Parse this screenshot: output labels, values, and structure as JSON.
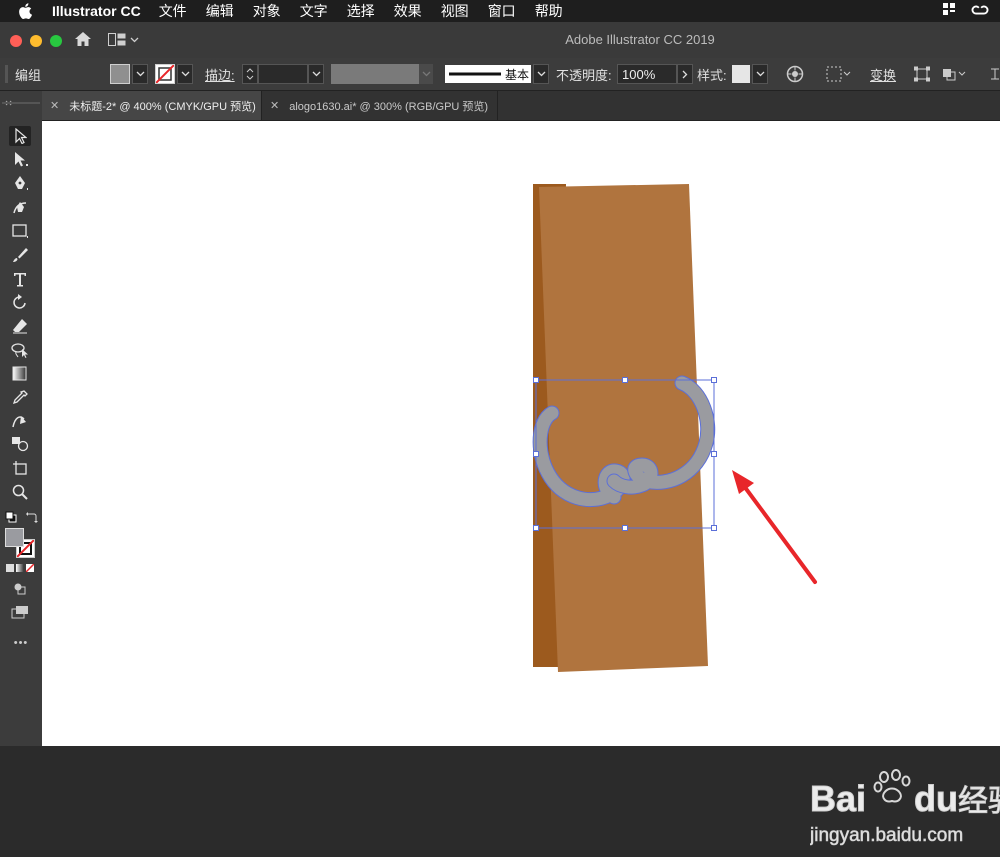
{
  "menubar": {
    "app_name": "Illustrator CC",
    "items": [
      "文件",
      "编辑",
      "对象",
      "文字",
      "选择",
      "效果",
      "视图",
      "窗口",
      "帮助"
    ]
  },
  "window": {
    "title": "Adobe Illustrator CC 2019"
  },
  "control_bar": {
    "selection_label": "编组",
    "stroke_label": "描边:",
    "stroke_profile": "基本",
    "opacity_label": "不透明度:",
    "opacity_value": "100%",
    "style_label": "样式:",
    "transform_label": "变换"
  },
  "tabs": [
    {
      "label": "未标题-2* @ 400% (CMYK/GPU 预览)",
      "active": true
    },
    {
      "label": "alogo1630.ai* @ 300% (RGB/GPU 预览)",
      "active": false
    }
  ],
  "toolbar": {
    "more_label": "•••"
  },
  "colors": {
    "accent_red": "#e8262a",
    "wood": "#b0743e",
    "wood_dark": "#9c5a1e",
    "selection": "#5b6fd8",
    "ornament": "#9a9ba0"
  },
  "watermark": {
    "brand": "Baidu",
    "brand_cn": "经验",
    "url": "jingyan.baidu.com"
  }
}
